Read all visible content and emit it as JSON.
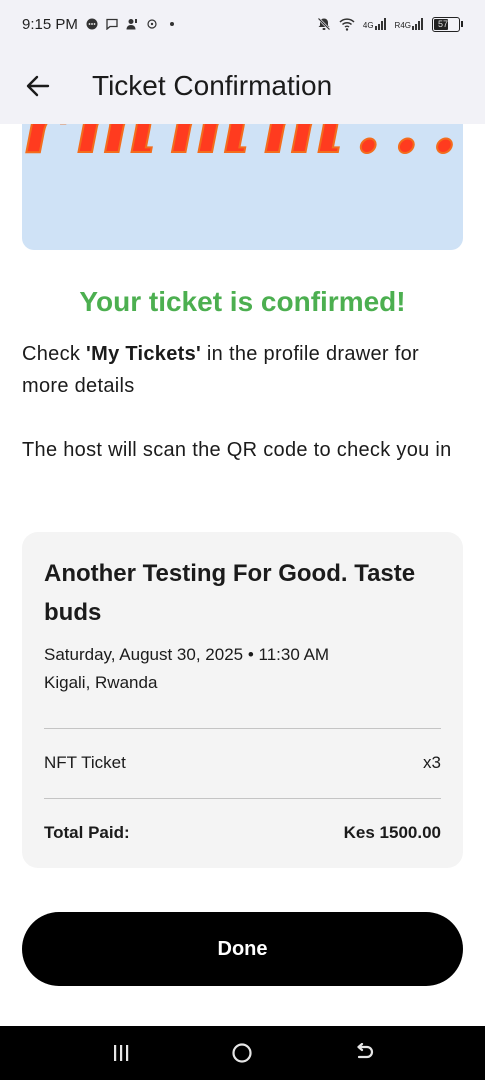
{
  "status_bar": {
    "time": "9:15 PM",
    "network_1": "4G",
    "network_2": "R4G",
    "battery": "57"
  },
  "app_bar": {
    "title": "Ticket Confirmation"
  },
  "banner": {
    "text": "rmmm..."
  },
  "confirmation": {
    "heading": "Your ticket is confirmed!",
    "line1_prefix": "Check ",
    "line1_bold": "'My Tickets'",
    "line1_suffix": " in the profile drawer for more details",
    "line2": "The host will scan the QR code to check you in"
  },
  "ticket_card": {
    "event_name": "Another Testing For Good. Taste buds",
    "datetime": "Saturday, August 30, 2025 • 11:30 AM",
    "location": "Kigali, Rwanda",
    "ticket_type": "NFT Ticket",
    "quantity": "x3",
    "total_label": "Total Paid:",
    "total_value": "Kes 1500.00"
  },
  "done_button": {
    "label": "Done"
  },
  "colors": {
    "accent_green": "#4caf50",
    "banner_bg": "#cfe2f6",
    "banner_text": "#ff3b1f"
  }
}
